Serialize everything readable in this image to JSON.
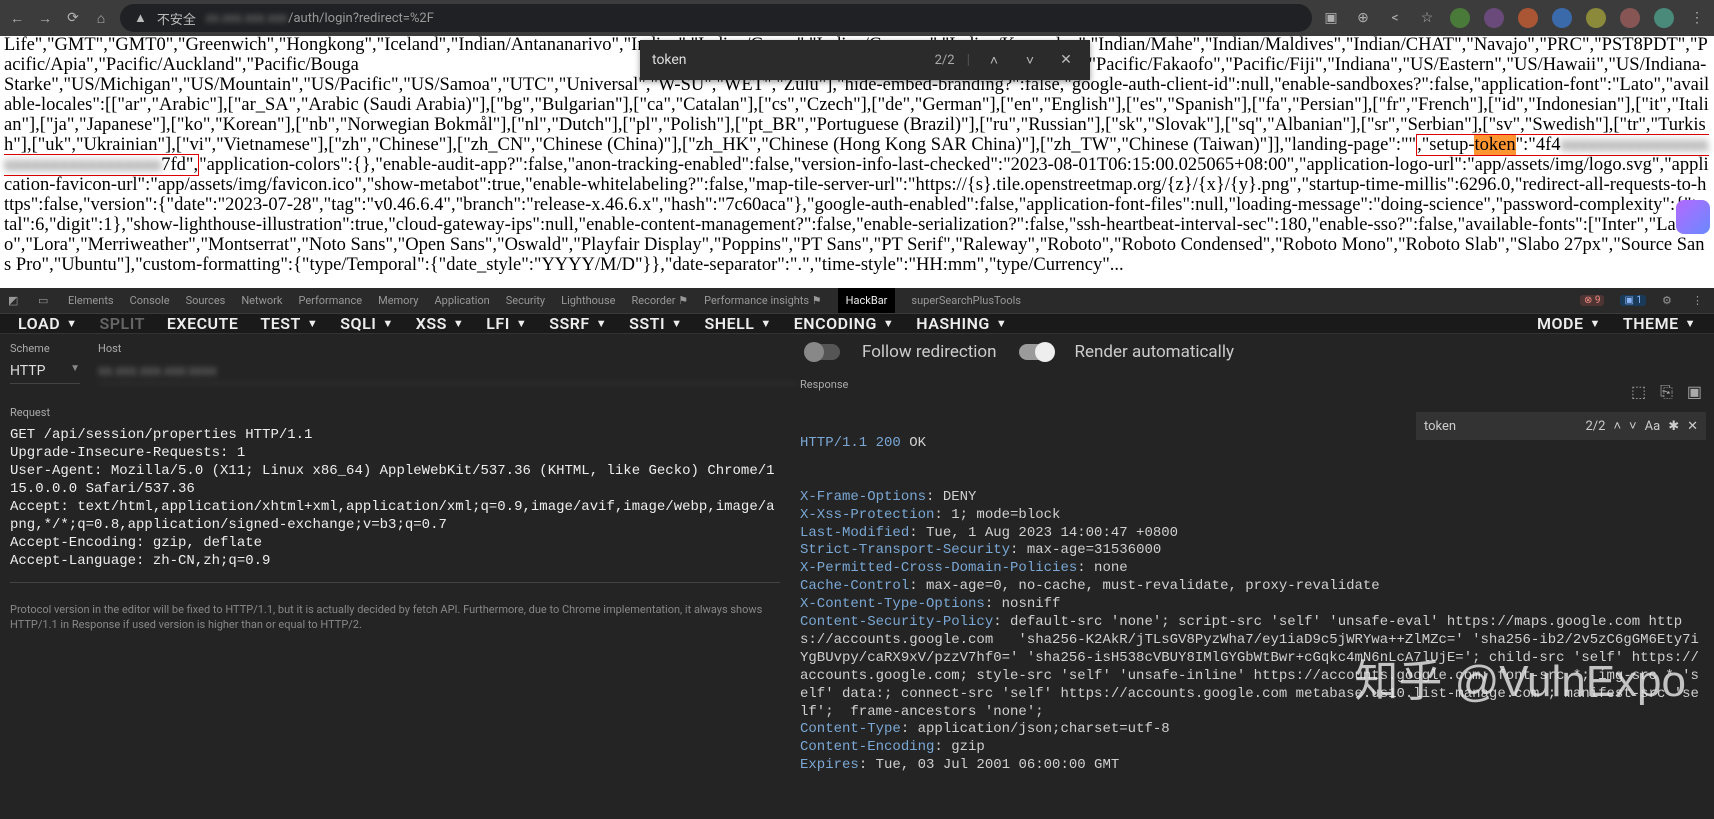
{
  "browser": {
    "insecure_label": "不安全",
    "url_obscured": "xx.xxx.xxx.xxx",
    "url_path": "/auth/login?redirect=%2F"
  },
  "find": {
    "query": "token",
    "count": "2/2"
  },
  "content": {
    "pre": "Life\",\"GMT\",\"GMT0\",\"Greenwich\",\"Hongkong\",\"Iceland\",\"Indian/Antananarivo\",\"Indian\",\"Indian/Cocos\",\"Indian/Comoro\",\"Indian/Kerguelen\",\"Indian/Mahe\",\"Indian/Maldives\",\"Indian/CHAT\",\"Navajo\",\"PRC\",\"PST8PDT\",\"Pacific/Apia\",\"Pacific/Auckland\",\"Pacific/Bouga",
    "pre2": "\"Pacific/Efate\",\"Pacific/Enderbury\",\"Pacific/Fakaofo\",\"Pacific/Fiji\",\"Indiana\",\"US/Eastern\",\"US/Hawaii\",\"US/Indiana-Starke\",\"US/Michigan\",\"US/Mountain\",\"US/Pacific\",\"US/Samoa\",\"UTC\",\"Universal\",\"W-SU\",\"WET\",\"Zulu\"],\"hide-embed-branding?\":false,\"google-auth-client-id\":null,\"enable-sandboxes?\":false,\"application-font\":\"Lato\",\"available-locales\":[[\"ar\",\"Arabic\"],[\"ar_SA\",\"Arabic (Saudi Arabia)\"],[\"bg\",\"Bulgarian\"],[\"ca\",\"Catalan\"],[\"cs\",\"Czech\"],[\"de\",\"German\"],[\"en\",\"English\"],[\"es\",\"Spanish\"],[\"fa\",\"Persian\"],[\"fr\",\"French\"],[\"id\",\"Indonesian\"],[\"it\",\"Italian\"],[\"ja\",\"Japanese\"],[\"ko\",\"Korean\"],[\"nb\",\"Norwegian Bokmål\"],[\"nl\",\"Dutch\"],[\"pl\",\"Polish\"],[\"pt_BR\",\"Portuguese (Brazil)\"],[\"ru\",\"Russian\"],[\"sk\",\"Slovak\"],[\"sq\",\"Albanian\"],[\"sr\",\"Serbian\"],[\"sv\",\"Swedish\"],[\"tr\",\"Turkish\"],[\"uk\",\"Ukrainian\"],[\"vi\",\"Vietnamese\"],[\"zh\",\"Chinese\"],[\"zh_CN\",\"Chinese (China)\"],[\"zh_HK\",\"Chinese (Hong Kong SAR China)\"],[\"zh_TW\",\"Chinese (Taiwan)\"]],\"landing-page\":\"\"",
    "hl_pre": ",\"setup-",
    "hl_mark": "token",
    "hl_post": "\":\"4f4",
    "hl_blur": "xxxxxxxxxxxxxxxxxxxxxxxxxxxxxxxxx",
    "hl_end": "7fd\",",
    "post": "\"application-colors\":{},\"enable-audit-app?\":false,\"anon-tracking-enabled\":false,\"version-info-last-checked\":\"2023-08-01T06:15:00.025065+08:00\",\"application-logo-url\":\"app/assets/img/logo.svg\",\"application-favicon-url\":\"app/assets/img/favicon.ico\",\"show-metabot\":true,\"enable-whitelabeling?\":false,\"map-tile-server-url\":\"https://{s}.tile.openstreetmap.org/{z}/{x}/{y}.png\",\"startup-time-millis\":6296.0,\"redirect-all-requests-to-https\":false,\"version\":{\"date\":\"2023-07-28\",\"tag\":\"v0.46.6.4\",\"branch\":\"release-x.46.6.x\",\"hash\":\"7c60aca\"},\"google-auth-enabled\":false,\"application-font-files\":null,\"loading-message\":\"doing-science\",\"password-complexity\":{\"total\":6,\"digit\":1},\"show-lighthouse-illustration\":true,\"cloud-gateway-ips\":null,\"enable-content-management?\":false,\"enable-serialization?\":false,\"ssh-heartbeat-interval-sec\":180,\"enable-sso?\":false,\"available-fonts\":[\"Inter\",\"Lato\",\"Lora\",\"Merriweather\",\"Montserrat\",\"Noto Sans\",\"Open Sans\",\"Oswald\",\"Playfair Display\",\"Poppins\",\"PT Sans\",\"PT Serif\",\"Raleway\",\"Roboto\",\"Roboto Condensed\",\"Roboto Mono\",\"Roboto Slab\",\"Slabo 27px\",\"Source Sans Pro\",\"Ubuntu\"],\"custom-formatting\":{\"type/Temporal\":{\"date_style\":\"YYYY/M/D\"}},\"date-separator\":\".\",\"time-style\":\"HH:mm\",\"type/Currency\"..."
  },
  "devtools": {
    "tabs": [
      "Elements",
      "Console",
      "Sources",
      "Network",
      "Performance",
      "Memory",
      "Application",
      "Security",
      "Lighthouse",
      "Recorder ⚑",
      "Performance insights ⚑",
      "HackBar",
      "superSearchPlusTools"
    ],
    "active_tab": "HackBar",
    "errors": "9",
    "info": "1"
  },
  "hackbar": {
    "buttons": {
      "load": "LOAD",
      "split": "SPLIT",
      "execute": "EXECUTE",
      "test": "TEST",
      "sqli": "SQLI",
      "xss": "XSS",
      "lfi": "LFI",
      "ssrf": "SSRF",
      "ssti": "SSTI",
      "shell": "SHELL",
      "encoding": "ENCODING",
      "hashing": "HASHING",
      "mode": "MODE",
      "theme": "THEME"
    },
    "scheme_label": "Scheme",
    "scheme_value": "HTTP",
    "host_label": "Host",
    "host_value": "xx.xxx.xxx.xxx:xxxx",
    "request_label": "Request",
    "request_text": "GET /api/session/properties HTTP/1.1\nUpgrade-Insecure-Requests: 1\nUser-Agent: Mozilla/5.0 (X11; Linux x86_64) AppleWebKit/537.36 (KHTML, like Gecko) Chrome/115.0.0.0 Safari/537.36\nAccept: text/html,application/xhtml+xml,application/xml;q=0.9,image/avif,image/webp,image/apng,*/*;q=0.8,application/signed-exchange;v=b3;q=0.7\nAccept-Encoding: gzip, deflate\nAccept-Language: zh-CN,zh;q=0.9",
    "note": "Protocol version in the editor will be fixed to HTTP/1.1, but it is actually decided by fetch API. Furthermore, due to Chrome implementation, it always shows HTTP/1.1 in Response if used version is higher than or equal to HTTP/2.",
    "follow_label": "Follow redirection",
    "render_label": "Render automatically",
    "response_label": "Response",
    "resp_search": {
      "query": "token",
      "count": "2/2"
    },
    "resp_status_line": {
      "proto": "HTTP/1.1 200",
      "ok": " OK"
    },
    "headers": [
      {
        "k": "X-Frame-Options",
        "v": ": DENY"
      },
      {
        "k": "X-Xss-Protection",
        "v": ": 1; mode=block"
      },
      {
        "k": "Last-Modified",
        "v": ": Tue, 1 Aug 2023 14:00:47 +0800"
      },
      {
        "k": "Strict-Transport-Security",
        "v": ": max-age=31536000"
      },
      {
        "k": "X-Permitted-Cross-Domain-Policies",
        "v": ": none"
      },
      {
        "k": "Cache-Control",
        "v": ": max-age=0, no-cache, must-revalidate, proxy-revalidate"
      },
      {
        "k": "X-Content-Type-Options",
        "v": ": nosniff"
      },
      {
        "k": "Content-Security-Policy",
        "v": ": default-src 'none'; script-src 'self' 'unsafe-eval' https://maps.google.com https://accounts.google.com   'sha256-K2AkR/jTLsGV8PyzWha7/ey1iaD9c5jWRYwa++ZlMZc=' 'sha256-ib2/2v5zC6gGM6Ety7iYgBUvpy/caRX9xV/pzzV7hf0=' 'sha256-isH538cVBUY8IMlGYGbWtBwr+cGqkc4mN6nLcA7lUjE='; child-src 'self' https://accounts.google.com; style-src 'self' 'unsafe-inline' https://accounts.google.com; font-src *; img-src * 'self' data:; connect-src 'self' https://accounts.google.com metabase.us10.list-manage.com ; manifest-src 'self';  frame-ancestors 'none';"
      },
      {
        "k": "Content-Type",
        "v": ": application/json;charset=utf-8"
      },
      {
        "k": "Content-Encoding",
        "v": ": gzip"
      },
      {
        "k": "Expires",
        "v": ": Tue, 03 Jul 2001 06:00:00 GMT"
      }
    ]
  },
  "watermark": "知乎 @VulnExpo"
}
